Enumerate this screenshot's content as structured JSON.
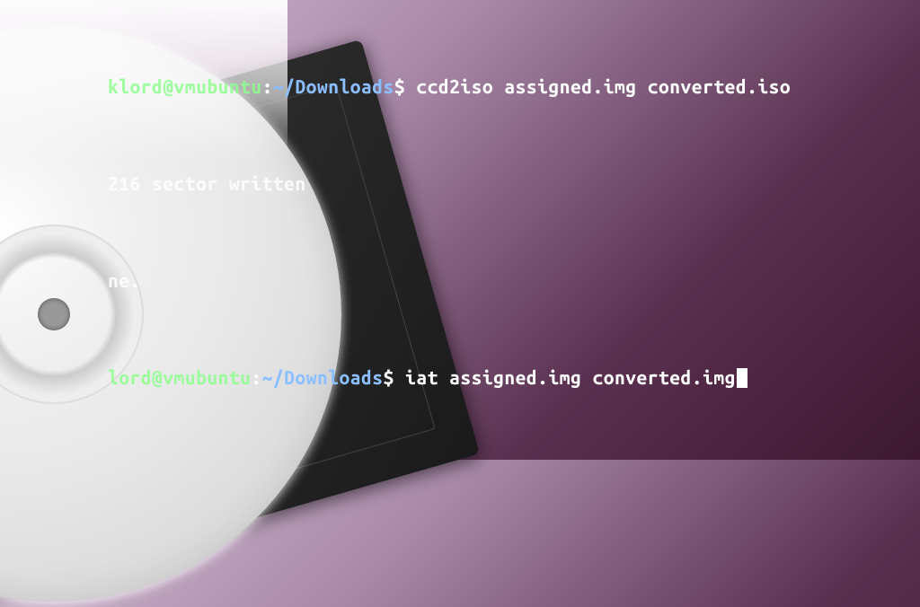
{
  "terminal": {
    "prompt1_user": "klord@vmubuntu",
    "prompt1_path": "~/Downloads",
    "prompt1_sep": ":",
    "prompt1_end": "$",
    "cmd1": "ccd2iso assigned.img converted.iso",
    "out1": "216 sector written",
    "out2": "ne.",
    "prompt2_user": "lord@vmubuntu",
    "prompt2_path": "~/Downloads",
    "prompt2_sep": ":",
    "prompt2_end": "$",
    "cmd2": "iat assigned.img converted.img"
  }
}
